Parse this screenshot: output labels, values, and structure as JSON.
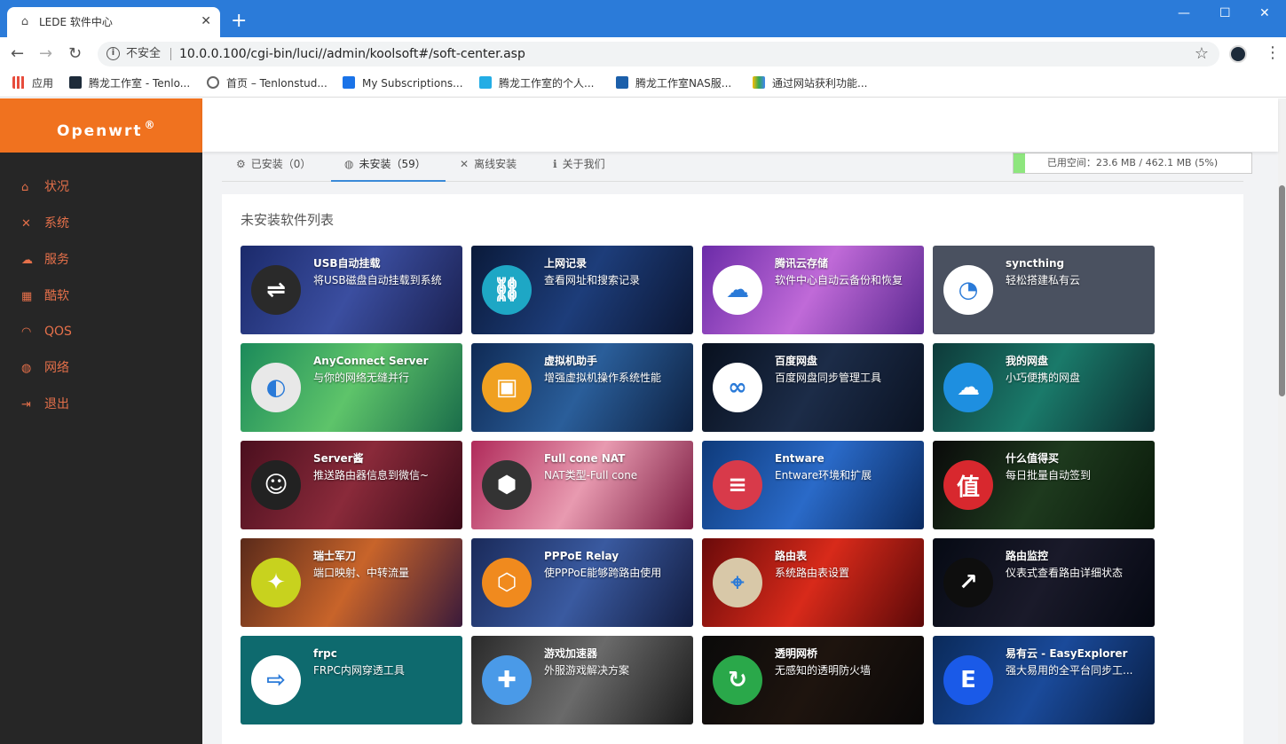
{
  "browser": {
    "tab_title": "LEDE 软件中心",
    "insecure_label": "不安全",
    "url": "10.0.0.100/cgi-bin/luci//admin/koolsoft#/soft-center.asp",
    "bookmarks": [
      {
        "label": "应用",
        "color": "#e74c3c"
      },
      {
        "label": "腾龙工作室 - Tenlo...",
        "color": "#1d2b3a"
      },
      {
        "label": "首页 – Tenlonstud...",
        "color": "#666666"
      },
      {
        "label": "My Subscriptions...",
        "color": "#1a73e8"
      },
      {
        "label": "腾龙工作室的个人...",
        "color": "#23ade5"
      },
      {
        "label": "腾龙工作室NAS服...",
        "color": "#1b5faa"
      },
      {
        "label": "通过网站获利功能...",
        "color": "#fbbc04"
      }
    ]
  },
  "sidebar": {
    "brand": "Openwrt",
    "brand_mark": "®",
    "items": [
      {
        "label": "状况",
        "icon": "home-icon"
      },
      {
        "label": "系统",
        "icon": "tools-icon"
      },
      {
        "label": "服务",
        "icon": "cloud-icon"
      },
      {
        "label": "酷软",
        "icon": "calendar-icon"
      },
      {
        "label": "QOS",
        "icon": "gauge-icon"
      },
      {
        "label": "网络",
        "icon": "globe-icon"
      },
      {
        "label": "退出",
        "icon": "logout-icon"
      }
    ]
  },
  "tabs": [
    {
      "label": "已安装（0）",
      "icon": "gear-icon",
      "active": false
    },
    {
      "label": "未安装（59）",
      "icon": "globe-icon",
      "active": true
    },
    {
      "label": "离线安装",
      "icon": "tools-icon",
      "active": false
    },
    {
      "label": "关于我们",
      "icon": "info-icon",
      "active": false
    }
  ],
  "storage": {
    "label": "已用空间：23.6 MB / 462.1 MB (5%)",
    "percent": 5
  },
  "panel_title": "未安装软件列表",
  "apps": [
    {
      "title": "USB自动挂载",
      "desc": "将USB磁盘自动挂载到系统",
      "bg": "linear-gradient(120deg,#1b2a6b,#3b4ea0,#1a2050)",
      "icon_bg": "#2a2a2a",
      "glyph": "⇌"
    },
    {
      "title": "上网记录",
      "desc": "查看网址和搜索记录",
      "bg": "linear-gradient(120deg,#0a1a3a,#1d3d7a,#0b1633)",
      "icon_bg": "#1ea7c5",
      "glyph": "⛓"
    },
    {
      "title": "腾讯云存储",
      "desc": "软件中心自动云备份和恢复",
      "bg": "linear-gradient(120deg,#6b2ba8,#c06ad8,#5a2890)",
      "icon_bg": "#ffffff",
      "glyph": "☁"
    },
    {
      "title": "syncthing",
      "desc": "轻松搭建私有云",
      "bg": "#4a5160",
      "icon_bg": "#ffffff",
      "glyph": "◔"
    },
    {
      "title": "AnyConnect Server",
      "desc": "与你的网络无缝并行",
      "bg": "linear-gradient(120deg,#1b8a5a,#5ec46a,#1a6d4a)",
      "icon_bg": "#e8e8e8",
      "glyph": "◐"
    },
    {
      "title": "虚拟机助手",
      "desc": "增强虚拟机操作系统性能",
      "bg": "linear-gradient(120deg,#0f2a55,#2a5e9a,#0d2040)",
      "icon_bg": "#f0a020",
      "glyph": "▣"
    },
    {
      "title": "百度网盘",
      "desc": "百度网盘同步管理工具",
      "bg": "linear-gradient(120deg,#08101e,#1c2c48,#0a1222)",
      "icon_bg": "#ffffff",
      "glyph": "∞"
    },
    {
      "title": "我的网盘",
      "desc": "小巧便携的网盘",
      "bg": "linear-gradient(120deg,#0e3a3a,#1a7a6a,#0b2e30)",
      "icon_bg": "#1e8fe0",
      "glyph": "☁"
    },
    {
      "title": "Server酱",
      "desc": "推送路由器信息到微信~",
      "bg": "linear-gradient(120deg,#4a0f1e,#8a2a3a,#3a0a18)",
      "icon_bg": "#222222",
      "glyph": "☺"
    },
    {
      "title": "Full cone NAT",
      "desc": "NAT类型-Full cone",
      "bg": "linear-gradient(120deg,#b02a5a,#e89ab0,#7a1a40)",
      "icon_bg": "#333333",
      "glyph": "⬢"
    },
    {
      "title": "Entware",
      "desc": "Entware环境和扩展",
      "bg": "linear-gradient(120deg,#0e3a7a,#2a6ac8,#0a2a60)",
      "icon_bg": "#d83a4a",
      "glyph": "≡"
    },
    {
      "title": "什么值得买",
      "desc": "每日批量自动签到",
      "bg": "linear-gradient(120deg,#0a0a0a,#1e3a1e,#0a1a0a)",
      "icon_bg": "#d8282e",
      "glyph": "值"
    },
    {
      "title": "瑞士军刀",
      "desc": "端口映射、中转流量",
      "bg": "linear-gradient(120deg,#5a2a1a,#c8642a,#3a1a3a)",
      "icon_bg": "#c8d21e",
      "glyph": "✦"
    },
    {
      "title": "PPPoE Relay",
      "desc": "使PPPoE能够跨路由使用",
      "bg": "linear-gradient(120deg,#1a2a5a,#3a5aa0,#121c40)",
      "icon_bg": "#f08a1e",
      "glyph": "⬡"
    },
    {
      "title": "路由表",
      "desc": "系统路由表设置",
      "bg": "linear-gradient(120deg,#6a0a0a,#d82a1a,#5a0808)",
      "icon_bg": "#d8c8a8",
      "glyph": "⌖"
    },
    {
      "title": "路由监控",
      "desc": "仪表式查看路由详细状态",
      "bg": "linear-gradient(120deg,#060a14,#1a1a2a,#050812)",
      "icon_bg": "#0e0e0e",
      "glyph": "↗"
    },
    {
      "title": "frpc",
      "desc": "FRPC内网穿透工具",
      "bg": "#0e6a6e",
      "icon_bg": "#ffffff",
      "glyph": "⇨"
    },
    {
      "title": "游戏加速器",
      "desc": "外服游戏解决方案",
      "bg": "linear-gradient(120deg,#2a2a2a,#6a6a6a,#1a1a1a)",
      "icon_bg": "#4a9ae8",
      "glyph": "✚"
    },
    {
      "title": "透明网桥",
      "desc": "无感知的透明防火墙",
      "bg": "linear-gradient(120deg,#0a0a0a,#1e140e,#0a0808)",
      "icon_bg": "#2aa84a",
      "glyph": "↻"
    },
    {
      "title": "易有云 - EasyExplorer",
      "desc": "强大易用的全平台同步工...",
      "bg": "linear-gradient(120deg,#0a2a5a,#1a4a9a,#081e44)",
      "icon_bg": "#1a5ae8",
      "glyph": "E"
    }
  ]
}
